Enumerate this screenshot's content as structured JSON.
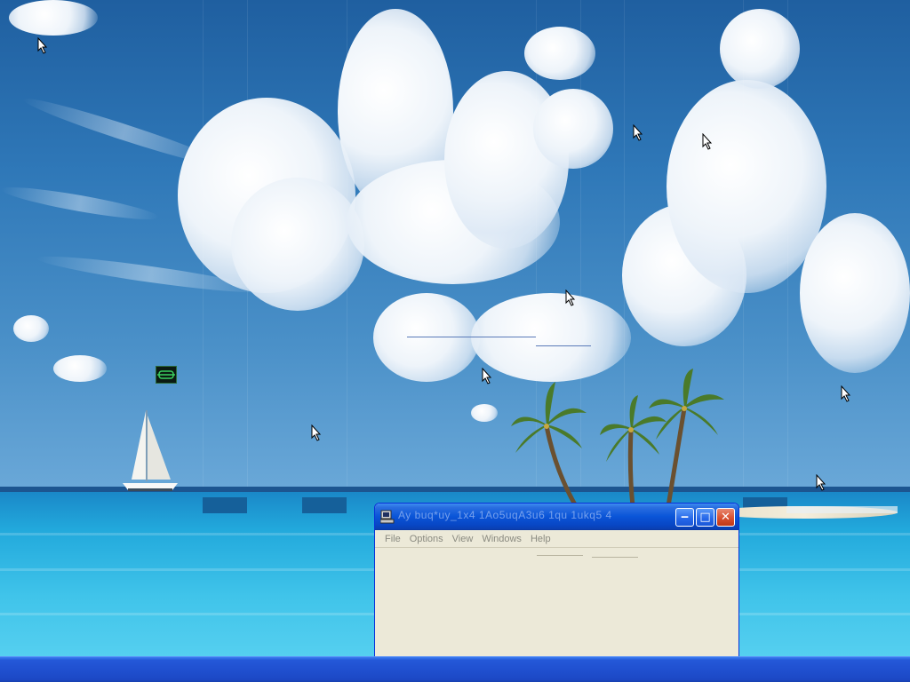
{
  "desktop": {
    "wallpaper": "tropical beach with sailboat and palm trees",
    "icon": "green-device-icon",
    "accent_colors": {
      "sky": "#2f78b8",
      "sea": "#22a9dc",
      "taskbar": "#2050d0"
    }
  },
  "window": {
    "title": "Ay  buq*uy_1x4 1Ao5uqA3u6 1qu 1ukq5 4",
    "icon": "computer-icon",
    "buttons": {
      "minimize": "‒",
      "maximize": "□",
      "close": "✕"
    },
    "menu": [
      "File",
      "Options",
      "View",
      "Windows",
      "Help"
    ]
  },
  "taskbar": {
    "color": "#2050d0"
  }
}
